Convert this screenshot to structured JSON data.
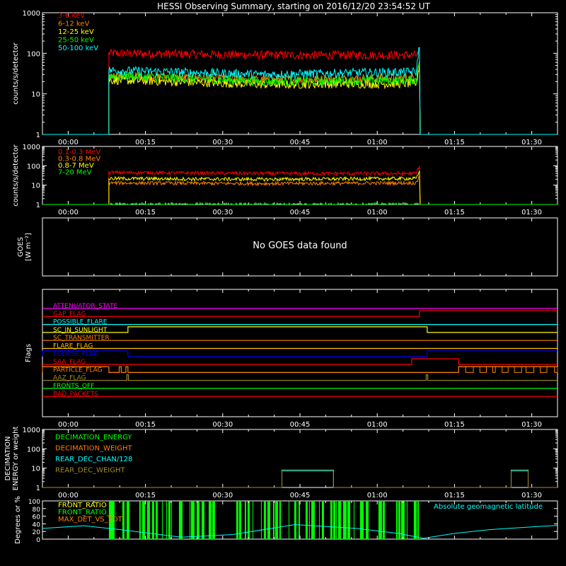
{
  "title": "HESSI Observing Summary, starting on 2016/12/20 23:54:52 UT",
  "time_ticks": [
    "00:00",
    "00:15",
    "00:30",
    "00:45",
    "01:00",
    "01:15",
    "01:30"
  ],
  "colors": {
    "white": "#ffffff",
    "red": "#ff0000",
    "orange": "#ff8000",
    "yellow": "#ffff00",
    "green": "#00ff00",
    "cyan": "#00ffff",
    "magenta": "#ff00ff",
    "blue": "#0000ff",
    "olive": "#a08c28",
    "amber": "#ffc000"
  },
  "goes": {
    "ylabel_1": "GOES",
    "ylabel_2": "[W m⁻²]",
    "message": "No GOES data found"
  },
  "chart_data": [
    {
      "name": "lo_energy_rates",
      "type": "line",
      "ylabel": "counts/s/detector",
      "yscale": "log",
      "ylim": [
        1,
        1000
      ],
      "ytick_labels": [
        "1",
        "10",
        "100",
        "1000"
      ],
      "xlim_minutes": [
        -5,
        95
      ],
      "data_start_min": 7.9,
      "data_end_min": 68.2,
      "series": [
        {
          "name": "3-6 keV",
          "color": "#ff0000",
          "start": 100,
          "mid": 90,
          "end": 90,
          "final": 95
        },
        {
          "name": "6-12 keV",
          "color": "#ff8000",
          "start": 28,
          "mid": 22,
          "end": 25,
          "final": 60
        },
        {
          "name": "12-25 keV",
          "color": "#ffff00",
          "start": 22,
          "mid": 17,
          "end": 18,
          "final": 50
        },
        {
          "name": "25-50 keV",
          "color": "#00ff00",
          "start": 28,
          "mid": 20,
          "end": 22,
          "final": 80
        },
        {
          "name": "50-100 keV",
          "color": "#00ffff",
          "start": 38,
          "mid": 30,
          "end": 35,
          "final": 150
        }
      ]
    },
    {
      "name": "hi_energy_rates",
      "type": "line",
      "ylabel": "counts/s/detector",
      "yscale": "log",
      "ylim": [
        1,
        1000
      ],
      "ytick_labels": [
        "1",
        "10",
        "100",
        "1000"
      ],
      "xlim_minutes": [
        -5,
        95
      ],
      "data_start_min": 7.9,
      "data_end_min": 68.2,
      "series": [
        {
          "name": "0.1-0.3 MeV",
          "color": "#ff0000",
          "start": 45,
          "mid": 40,
          "end": 40,
          "final": 100
        },
        {
          "name": "0.3-0.8 MeV",
          "color": "#ff8000",
          "start": 13,
          "mid": 12,
          "end": 13,
          "final": 30
        },
        {
          "name": "0.8-7 MeV",
          "color": "#ffff00",
          "start": 22,
          "mid": 20,
          "end": 22,
          "final": 50
        },
        {
          "name": "7-20 MeV",
          "color": "#00ff00",
          "start": 1,
          "mid": 1,
          "end": 1,
          "final": 1
        }
      ]
    },
    {
      "name": "flags",
      "type": "line",
      "ylabel": "Flags",
      "xlim_minutes": [
        -5,
        95
      ],
      "series": [
        {
          "name": "ATTENUATOR_STATE",
          "color": "#ff00ff",
          "on_intervals": []
        },
        {
          "name": "GAP_FLAG",
          "color": "#ff0000",
          "on_intervals": [
            [
              68.2,
              95
            ]
          ]
        },
        {
          "name": "POSSIBLE_FLARE",
          "color": "#00ffff",
          "on_intervals": []
        },
        {
          "name": "SC_IN_SUNLIGHT",
          "color": "#ffff00",
          "on_intervals": [
            [
              11.6,
              69.7
            ]
          ]
        },
        {
          "name": "SC_TRANSMITTER",
          "color": "#ff8000",
          "on_intervals": []
        },
        {
          "name": "FLARE_FLAG",
          "color": "#ffc000",
          "on_intervals": []
        },
        {
          "name": "ECLIPSE_FLAG",
          "color": "#0000ff",
          "on_intervals": [
            [
              -5,
              11.6
            ],
            [
              69.7,
              95
            ]
          ]
        },
        {
          "name": "SAA_FLAG",
          "color": "#ff0000",
          "on_intervals": [
            [
              66.7,
              75.8
            ]
          ]
        },
        {
          "name": "PARTICLE_FLAG",
          "color": "#ff8000",
          "on_intervals": [
            [
              -5,
              7.9
            ],
            [
              9.9,
              10.3
            ],
            [
              11.2,
              11.6
            ],
            [
              75.8,
              95
            ]
          ]
        },
        {
          "name": "AAZ_FLAG",
          "color": "#a08c28",
          "on_intervals": [
            [
              11.4,
              11.7
            ],
            [
              69.5,
              69.8
            ]
          ]
        },
        {
          "name": "FRONTS_OFF",
          "color": "#00ff00",
          "on_intervals": []
        },
        {
          "name": "BAD_PACKETS",
          "color": "#ff0000",
          "on_intervals": []
        }
      ]
    },
    {
      "name": "decimation",
      "type": "line",
      "ylabel": "DECIMATION ENERGY or weight",
      "yscale": "log",
      "ylim": [
        1,
        1000
      ],
      "ytick_labels": [
        "1",
        "10",
        "100",
        "1000"
      ],
      "xlim_minutes": [
        -5,
        95
      ],
      "series": [
        {
          "name": "DECIMATION_ENERGY",
          "color": "#00ff00",
          "on_intervals": []
        },
        {
          "name": "DECIMATION_WEIGHT",
          "color": "#ff8000",
          "on_intervals": []
        },
        {
          "name": "REAR_DEC_CHAN/128",
          "color": "#00ffff",
          "on_intervals": [
            [
              41.5,
              51.5
            ],
            [
              86.0,
              89.3
            ]
          ],
          "on_value": 8
        },
        {
          "name": "REAR_DEC_WEIGHT",
          "color": "#a08c28",
          "on_intervals": [
            [
              41.5,
              51.5
            ],
            [
              86.0,
              89.3
            ]
          ],
          "on_value": 7
        }
      ]
    },
    {
      "name": "ratios_latitude",
      "type": "line",
      "ylabel": "Degrees or %",
      "ylim": [
        0,
        100
      ],
      "ytick_labels": [
        "0",
        "20",
        "40",
        "60",
        "80",
        "100"
      ],
      "xlim_minutes": [
        -5,
        95
      ],
      "annotation": "Absolute geomagnetic latitude",
      "series": [
        {
          "name": "FRONT_RATIO",
          "color": "#ffff00"
        },
        {
          "name": "FRONT_RATIO_...",
          "color": "#00ff00",
          "bars_between_min": [
            7.9,
            68.2
          ]
        },
        {
          "name": "MAX_DET_VS_TOT",
          "color": "#ff8000"
        }
      ],
      "latitude": {
        "color": "#00ffff",
        "minutes": [
          -5,
          3,
          10,
          22,
          32,
          44,
          56,
          64,
          69,
          75,
          82,
          90,
          95
        ],
        "degrees": [
          28,
          35,
          25,
          5,
          12,
          38,
          28,
          15,
          2,
          15,
          25,
          32,
          36
        ]
      }
    }
  ]
}
